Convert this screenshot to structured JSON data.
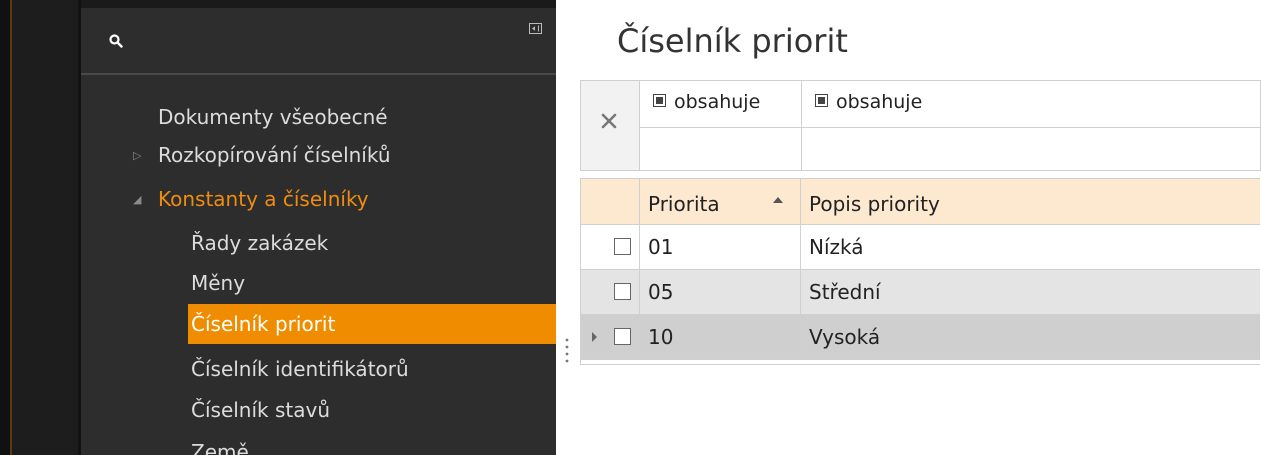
{
  "nav": {
    "items": [
      {
        "label": "Dokumenty všeobecné",
        "state": "normal",
        "level": 0,
        "arrow": ""
      },
      {
        "label": "Rozkopírování číselníků",
        "state": "normal",
        "level": 0,
        "arrow": "collapsed"
      },
      {
        "label": "Konstanty a číselníky",
        "state": "expanded-active",
        "level": 0,
        "arrow": "expanded"
      },
      {
        "label": "Řady zakázek",
        "state": "normal",
        "level": 1
      },
      {
        "label": "Měny",
        "state": "normal",
        "level": 1
      },
      {
        "label": "Číselník priorit",
        "state": "selected",
        "level": 1
      },
      {
        "label": "Číselník identifikátorů",
        "state": "normal",
        "level": 1
      },
      {
        "label": "Číselník stavů",
        "state": "normal",
        "level": 1
      },
      {
        "label": "Země",
        "state": "normal",
        "level": 1
      }
    ]
  },
  "main": {
    "title": "Číselník priorit",
    "filter": {
      "col1_operator": "obsahuje",
      "col2_operator": "obsahuje",
      "col1_value": "",
      "col2_value": ""
    },
    "grid": {
      "columns": [
        "Priorita",
        "Popis priority"
      ],
      "sort": {
        "column": "Priorita",
        "direction": "ascending"
      },
      "rows": [
        {
          "priorita": "01",
          "popis": "Nízká",
          "checked": false,
          "current": false
        },
        {
          "priorita": "05",
          "popis": "Střední",
          "checked": false,
          "current": false
        },
        {
          "priorita": "10",
          "popis": "Vysoká",
          "checked": false,
          "current": true
        }
      ]
    }
  },
  "colors": {
    "accent": "#f08c00",
    "nav_bg": "#2d2d2d",
    "header_bg": "#fde8d0"
  },
  "icons": [
    "search-icon",
    "collapse-panel-icon",
    "clear-filter-icon",
    "sort-ascending-icon",
    "row-pointer-icon",
    "splitter-grip-icon"
  ]
}
